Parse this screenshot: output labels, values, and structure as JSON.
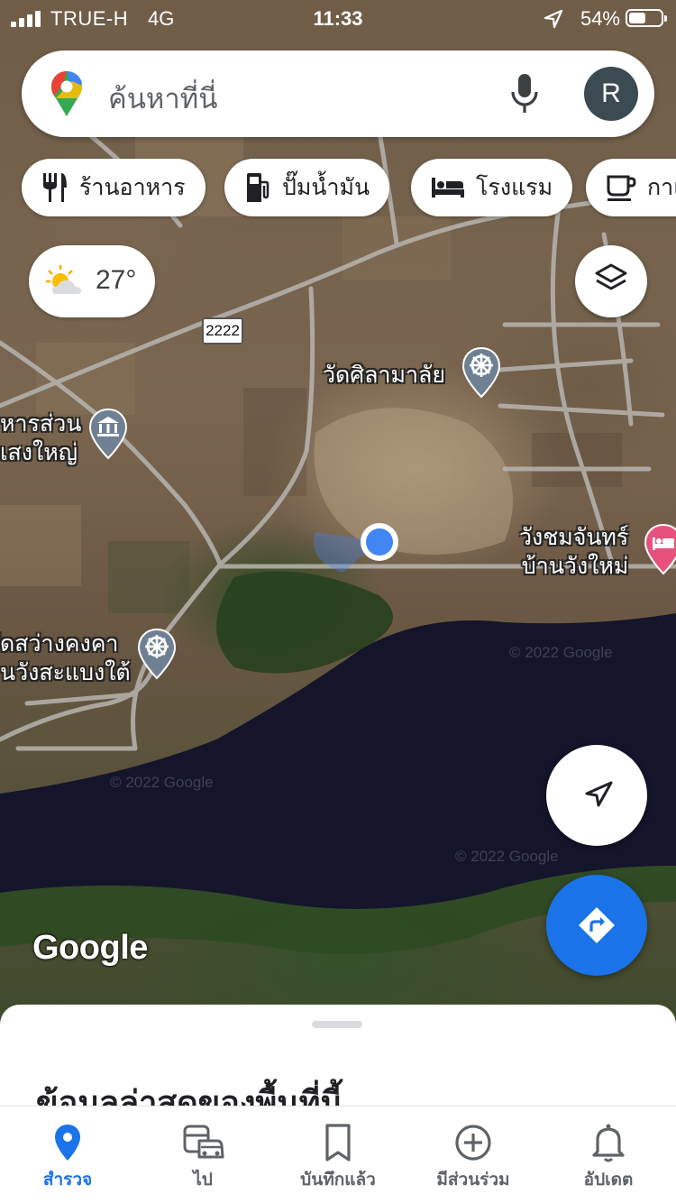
{
  "status_bar": {
    "carrier": "TRUE-H",
    "network": "4G",
    "time": "11:33",
    "battery_percent": "54%",
    "battery_level": 0.54
  },
  "search": {
    "placeholder": "ค้นหาที่นี่",
    "avatar_letter": "R"
  },
  "chips": [
    {
      "label": "ร้านอาหาร",
      "icon": "fork-knife-icon"
    },
    {
      "label": "ปั๊มน้ำมัน",
      "icon": "gas-pump-icon"
    },
    {
      "label": "โรงแรม",
      "icon": "bed-icon"
    },
    {
      "label": "กาแฟ",
      "icon": "coffee-cup-icon"
    }
  ],
  "weather": {
    "temperature": "27°",
    "icon": "partly-cloudy-icon"
  },
  "map": {
    "road_shield": "2222",
    "labels": {
      "wat_sila": "วัดศิลามาลัย",
      "museum_line1": "หารส่วน",
      "museum_line2": "เสงใหญ่",
      "wangchom_line1": "วังชมจันทร์",
      "wangchom_line2": "บ้านวังใหม่",
      "wat_sawang_line1": "ัดสว่างคงคา",
      "wat_sawang_line2": "นวังสะแบงใต้"
    },
    "watermarks": [
      "© 2022 Google",
      "© 2022 Google",
      "© 2022 Google"
    ],
    "logo": "Google"
  },
  "sheet": {
    "title": "ข้อมูลล่าสุดของพื้นที่นี้"
  },
  "nav": [
    {
      "label": "สำรวจ",
      "icon": "location-pin-icon",
      "active": true
    },
    {
      "label": "ไป",
      "icon": "commute-icon",
      "active": false
    },
    {
      "label": "บันทึกแล้ว",
      "icon": "bookmark-icon",
      "active": false
    },
    {
      "label": "มีส่วนร่วม",
      "icon": "add-circle-icon",
      "active": false
    },
    {
      "label": "อัปเดต",
      "icon": "bell-icon",
      "active": false
    }
  ],
  "colors": {
    "accent_blue": "#1a73e8",
    "location_dot": "#4285f4",
    "river": "#14152b",
    "hotel_pin": "#e8517c",
    "poi_pin": "#6e8091"
  }
}
